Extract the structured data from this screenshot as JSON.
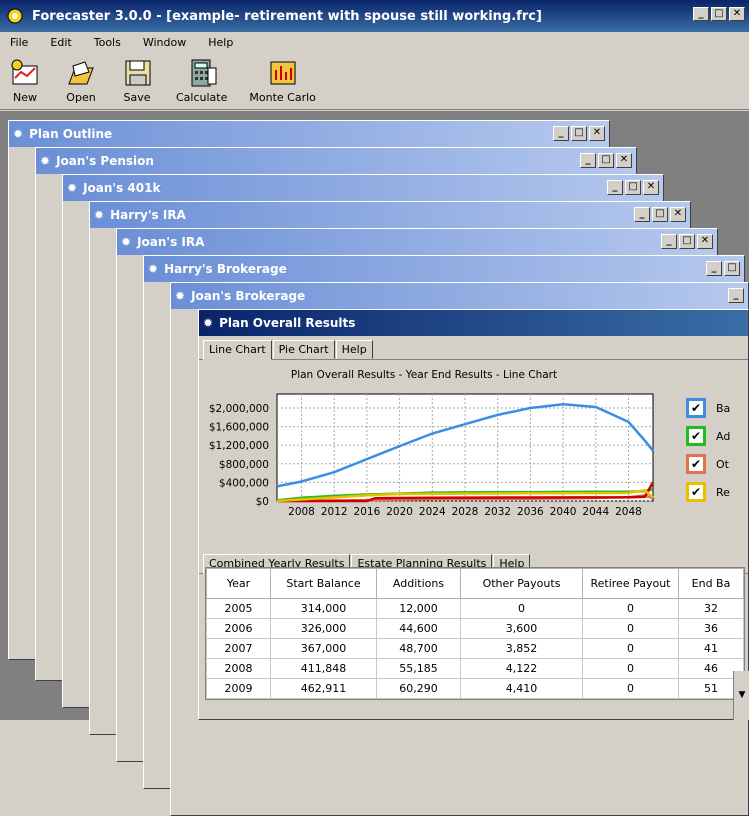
{
  "app": {
    "title": "Forecaster 3.0.0 - [example- retirement with spouse still working.frc]"
  },
  "menu": [
    "File",
    "Edit",
    "Tools",
    "Window",
    "Help"
  ],
  "toolbar": [
    {
      "label": "New",
      "icon": "new-plan-icon"
    },
    {
      "label": "Open",
      "icon": "open-folder-icon"
    },
    {
      "label": "Save",
      "icon": "save-disk-icon"
    },
    {
      "label": "Calculate",
      "icon": "calculator-icon"
    },
    {
      "label": "Monte Carlo",
      "icon": "monte-carlo-icon"
    }
  ],
  "windows": [
    "Plan Outline",
    "Joan's Pension",
    "Joan's 401k",
    "Harry's IRA",
    "Joan's IRA",
    "Harry's Brokerage",
    "Joan's Brokerage"
  ],
  "active": {
    "title": "Plan Overall Results",
    "top_tabs": [
      "Line Chart",
      "Pie Chart",
      "Help"
    ],
    "bottom_tabs": [
      "Combined Yearly Results",
      "Estate Planning Results",
      "Help"
    ],
    "legend": [
      {
        "label": "Ba",
        "color": "#3a8ee6"
      },
      {
        "label": "Ad",
        "color": "#22bb22"
      },
      {
        "label": "Ot",
        "color": "#e07050"
      },
      {
        "label": "Re",
        "color": "#e8c000"
      }
    ],
    "table": {
      "headers": [
        "Year",
        "Start Balance",
        "Additions",
        "Other Payouts",
        "Retiree Payout",
        "End Ba"
      ],
      "rows": [
        [
          "2005",
          "314,000",
          "12,000",
          "0",
          "0",
          "32"
        ],
        [
          "2006",
          "326,000",
          "44,600",
          "3,600",
          "0",
          "36"
        ],
        [
          "2007",
          "367,000",
          "48,700",
          "3,852",
          "0",
          "41"
        ],
        [
          "2008",
          "411,848",
          "55,185",
          "4,122",
          "0",
          "46"
        ],
        [
          "2009",
          "462,911",
          "60,290",
          "4,410",
          "0",
          "51"
        ]
      ]
    }
  },
  "chart_data": {
    "type": "line",
    "title": "Plan Overall Results - Year End Results - Line Chart",
    "xlabel": "",
    "ylabel": "",
    "x_ticks": [
      "2008",
      "2012",
      "2016",
      "2020",
      "2024",
      "2028",
      "2032",
      "2036",
      "2040",
      "2044",
      "2048"
    ],
    "y_ticks": [
      "$2,000,000",
      "$1,600,000",
      "$1,200,000",
      "$800,000",
      "$400,000",
      "$0"
    ],
    "xlim": [
      2005,
      2051
    ],
    "ylim": [
      0,
      2300000
    ],
    "series": [
      {
        "color": "#3a8ee6",
        "x": [
          2005,
          2008,
          2012,
          2016,
          2020,
          2024,
          2028,
          2032,
          2036,
          2040,
          2044,
          2048,
          2050,
          2051
        ],
        "y": [
          314000,
          420000,
          620000,
          900000,
          1180000,
          1450000,
          1650000,
          1850000,
          2000000,
          2080000,
          2020000,
          1700000,
          1300000,
          1080000
        ]
      },
      {
        "color": "#22bb22",
        "x": [
          2005,
          2008,
          2012,
          2016,
          2020,
          2024,
          2028,
          2032,
          2036,
          2040,
          2044,
          2048,
          2050,
          2051
        ],
        "y": [
          12000,
          70000,
          110000,
          140000,
          160000,
          180000,
          185000,
          190000,
          190000,
          195000,
          200000,
          200000,
          210000,
          250000
        ]
      },
      {
        "color": "#e07050",
        "x": [
          2005,
          2010,
          2016,
          2020,
          2024,
          2030,
          2036,
          2042,
          2048,
          2050,
          2051
        ],
        "y": [
          0,
          8000,
          20000,
          30000,
          40000,
          45000,
          50000,
          60000,
          80000,
          120000,
          60000
        ]
      },
      {
        "color": "#cc0000",
        "x": [
          2005,
          2016,
          2017,
          2024,
          2036,
          2048,
          2050,
          2051
        ],
        "y": [
          0,
          0,
          60000,
          70000,
          75000,
          80000,
          90000,
          400000
        ]
      },
      {
        "color": "#e8c000",
        "x": [
          2005,
          2016,
          2020,
          2028,
          2036,
          2044,
          2048,
          2050,
          2051
        ],
        "y": [
          0,
          120000,
          150000,
          160000,
          165000,
          170000,
          175000,
          230000,
          80000
        ]
      }
    ]
  }
}
